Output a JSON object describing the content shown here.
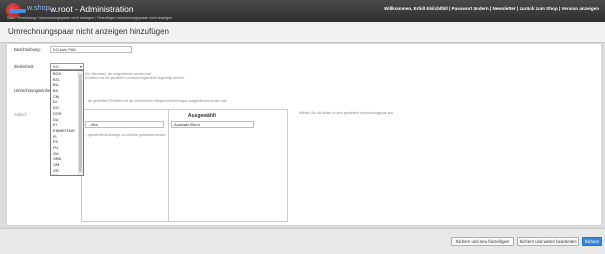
{
  "app": {
    "brand": "w.shop",
    "title": "w.root - Administration",
    "top_links": "Willkommen, Erhill Ekilcbllbll | Passwort ändern | Newsletter | zurück zum Shop | Version anzeigen",
    "breadcrumb": "Start / Einrichtung / Umrechnungspaare nicht anzeigen / Hinzufügen Umrechnungspaare nicht anzeigen"
  },
  "page": {
    "title": "Umrechnungspaar nicht anzeigen hinzufügen"
  },
  "form": {
    "description_label": "Beschreibung:",
    "description_value": "KG kein PAK",
    "target_unit_label": "Zieleinheit:",
    "target_unit_selected": "KG",
    "target_unit_hint_1": "Die Zieleinheit, die ausgeblendet werden soll.",
    "target_unit_hint_2": "Einheiten mit der gewählten Umrechnungseinheit angezeigt werden.",
    "assign_label": "Umrechnungseinheit:",
    "assign_hint": "...die gewählten Einheiten mit der Zieleinheit in Mengenumrechnungen ausgeblendet werden soll.",
    "article_label": "Artikel:",
    "left_filter_value": "...ffen",
    "selected_title": "Ausgewählt",
    "selected_filter_value": "Auswahl filtern",
    "left_hint": "...ngeschränkte Anzeige von Artikeln gebraucht werden.",
    "right_hint": "Wählen Sie die Artikel zu dem gewählten Umrechnungspaar aus."
  },
  "dropdown": {
    "options": [
      "BOX",
      "BTL",
      "BU",
      "BX",
      "CM",
      "DI",
      "DO",
      "DOS",
      "DU",
      "EI",
      "EINHEIT/UE",
      "FL",
      "FS",
      "FU",
      "GA",
      "GBD",
      "GM",
      "GR",
      "KA",
      "KG"
    ],
    "selected_index": 19
  },
  "footer": {
    "save_new_label": "Sichern und neu hinzufügen",
    "save_continue_label": "Sichern und weiter bearbeiten",
    "save_label": "Sichern"
  }
}
